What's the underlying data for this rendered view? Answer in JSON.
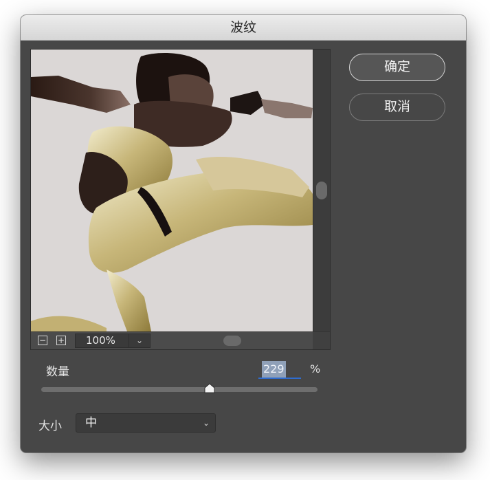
{
  "dialog": {
    "title": "波纹"
  },
  "buttons": {
    "ok_label": "确定",
    "cancel_label": "取消"
  },
  "preview": {
    "zoom_out_symbol": "−",
    "zoom_in_symbol": "+",
    "zoom_level": "100%",
    "zoom_dropdown_icon": "chevron-down-icon"
  },
  "amount": {
    "label": "数量",
    "value": "229",
    "unit": "%",
    "slider_fraction": 0.61
  },
  "size": {
    "label": "大小",
    "selected": "中"
  }
}
